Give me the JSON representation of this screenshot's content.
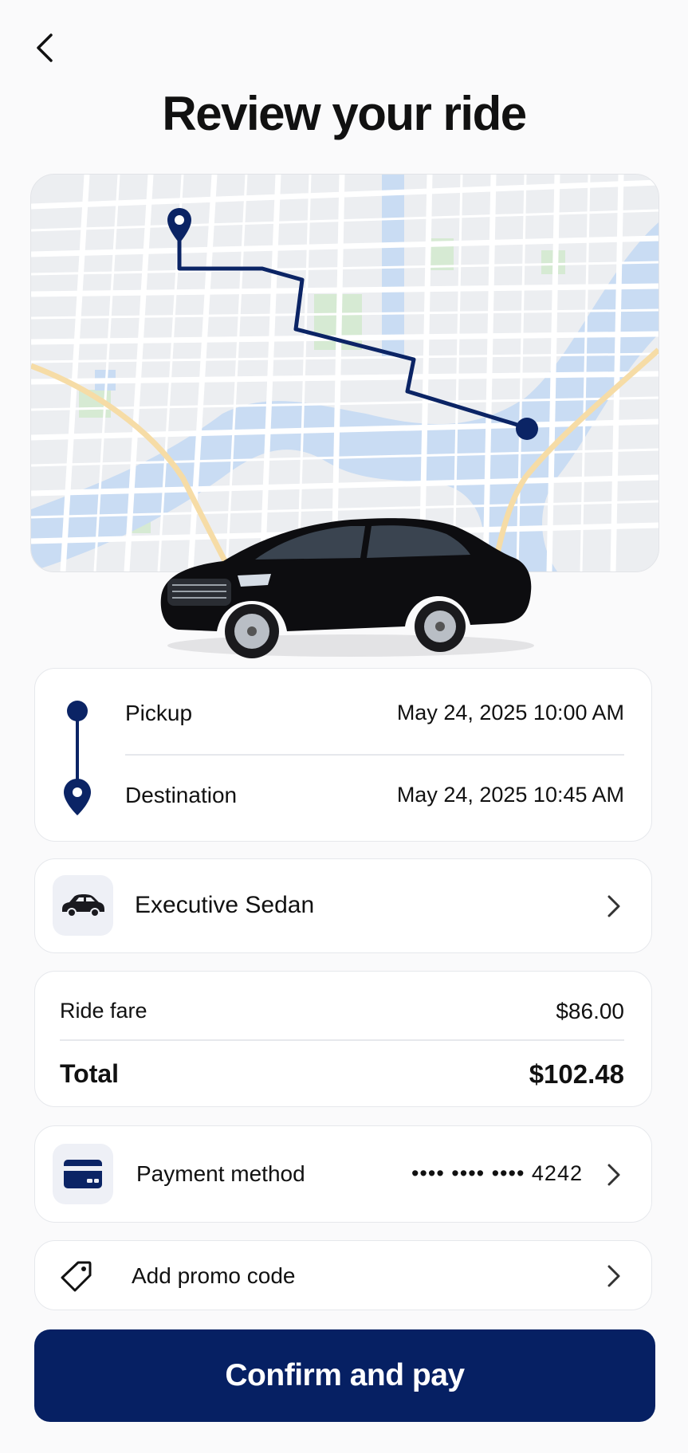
{
  "header": {
    "title": "Review your ride"
  },
  "trip": {
    "pickup_label": "Pickup",
    "pickup_time": "May 24, 2025 10:00 AM",
    "destination_label": "Destination",
    "destination_time": "May 24, 2025 10:45 AM"
  },
  "vehicle": {
    "name": "Executive Sedan"
  },
  "fare": {
    "ride_fare_label": "Ride fare",
    "ride_fare_value": "$86.00",
    "total_label": "Total",
    "total_value": "$102.48"
  },
  "payment": {
    "label": "Payment method",
    "card_mask": "•••• •••• •••• 4242"
  },
  "promo": {
    "label": "Add promo code"
  },
  "cta": {
    "label": "Confirm and pay"
  },
  "colors": {
    "accent": "#062063",
    "card_border": "#e6e8ec",
    "background": "#fafafb"
  },
  "icons": [
    "back-chevron-icon",
    "pickup-dot-icon",
    "destination-pin-icon",
    "car-icon",
    "credit-card-icon",
    "tag-icon",
    "chevron-right-icon"
  ]
}
